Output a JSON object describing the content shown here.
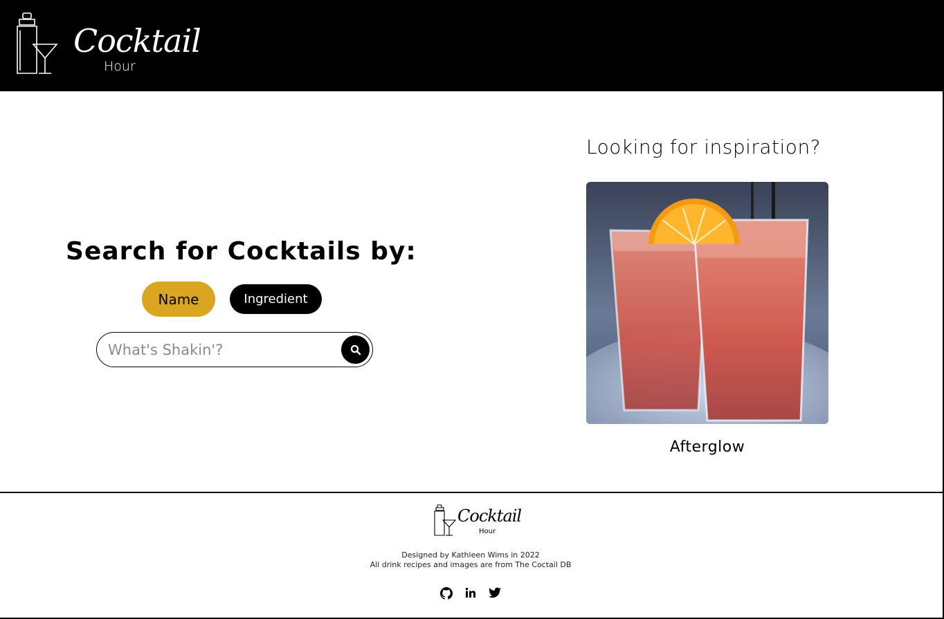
{
  "header": {
    "brand_script": "Cocktail",
    "brand_sub": "Hour"
  },
  "search": {
    "title": "Search for Cocktails by:",
    "toggles": [
      {
        "label": "Name",
        "active": true
      },
      {
        "label": "Ingredient",
        "active": false
      }
    ],
    "input_placeholder": "What's Shakin'?",
    "input_value": ""
  },
  "inspiration": {
    "title": "Looking for inspiration?",
    "drink_name": "Afterglow"
  },
  "footer": {
    "brand_script": "Cocktail",
    "brand_sub": "Hour",
    "designed_by": "Designed by Kathleen Wims in 2022",
    "source_note": "All drink recipes and images are from The Coctail DB",
    "social": [
      "github-icon",
      "linkedin-icon",
      "twitter-icon"
    ]
  },
  "colors": {
    "header_bg": "#000000",
    "active_toggle": "#daa520",
    "inactive_toggle": "#000000"
  }
}
